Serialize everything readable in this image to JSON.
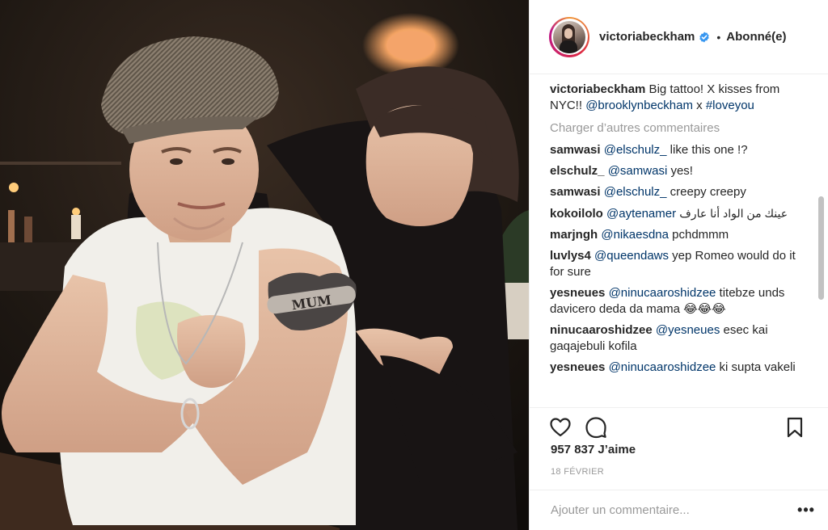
{
  "post": {
    "photo_alt": "",
    "header": {
      "username": "victoriabeckham",
      "verified": true,
      "separator": "•",
      "follow_label": "Abonné(e)"
    },
    "caption": {
      "username": "victoriabeckham",
      "text_1": " Big tattoo! X kisses from NYC!! ",
      "mention": "@brooklynbeckham",
      "text_2": " x ",
      "hashtag": "#loveyou"
    },
    "load_more_label": "Charger d’autres commentaires",
    "comments": [
      {
        "username": "samwasi",
        "mention": "@elschulz_",
        "text": " like this one !?"
      },
      {
        "username": "elschulz_",
        "mention": "@samwasi",
        "text": " yes!"
      },
      {
        "username": "samwasi",
        "mention": "@elschulz_",
        "text": " creepy creepy"
      },
      {
        "username": "kokoilolo",
        "mention": "@aytenamer",
        "text": "عينك من الواد أنا عارف"
      },
      {
        "username": "marjngh",
        "mention": "@nikaesdna",
        "text": " pchdmmm"
      },
      {
        "username": "luvlys4",
        "mention": "@queendaws",
        "text": " yep Romeo would do it for sure"
      },
      {
        "username": "yesneues",
        "mention": "@ninucaaroshidzee",
        "text": " titebze unds davicero deda da mama 😂😂😂"
      },
      {
        "username": "ninucaaroshidzee",
        "mention": "@yesneues",
        "text": " esec kai gaqajebuli kofila"
      },
      {
        "username": "yesneues",
        "mention": "@ninucaaroshidzee",
        "text": " ki supta vakeli"
      }
    ],
    "likes_label": "957 837 J’aime",
    "date_label": "18 FÉVRIER",
    "add_comment_placeholder": "Ajouter un commentaire...",
    "more_label": "•••",
    "colors": {
      "link": "#003569",
      "muted": "#999999",
      "text": "#262626",
      "verified": "#3897f0"
    },
    "icons": {
      "like": "heart-icon",
      "comment": "speech-bubble-icon",
      "save": "bookmark-icon",
      "verified": "verified-badge-icon"
    }
  }
}
